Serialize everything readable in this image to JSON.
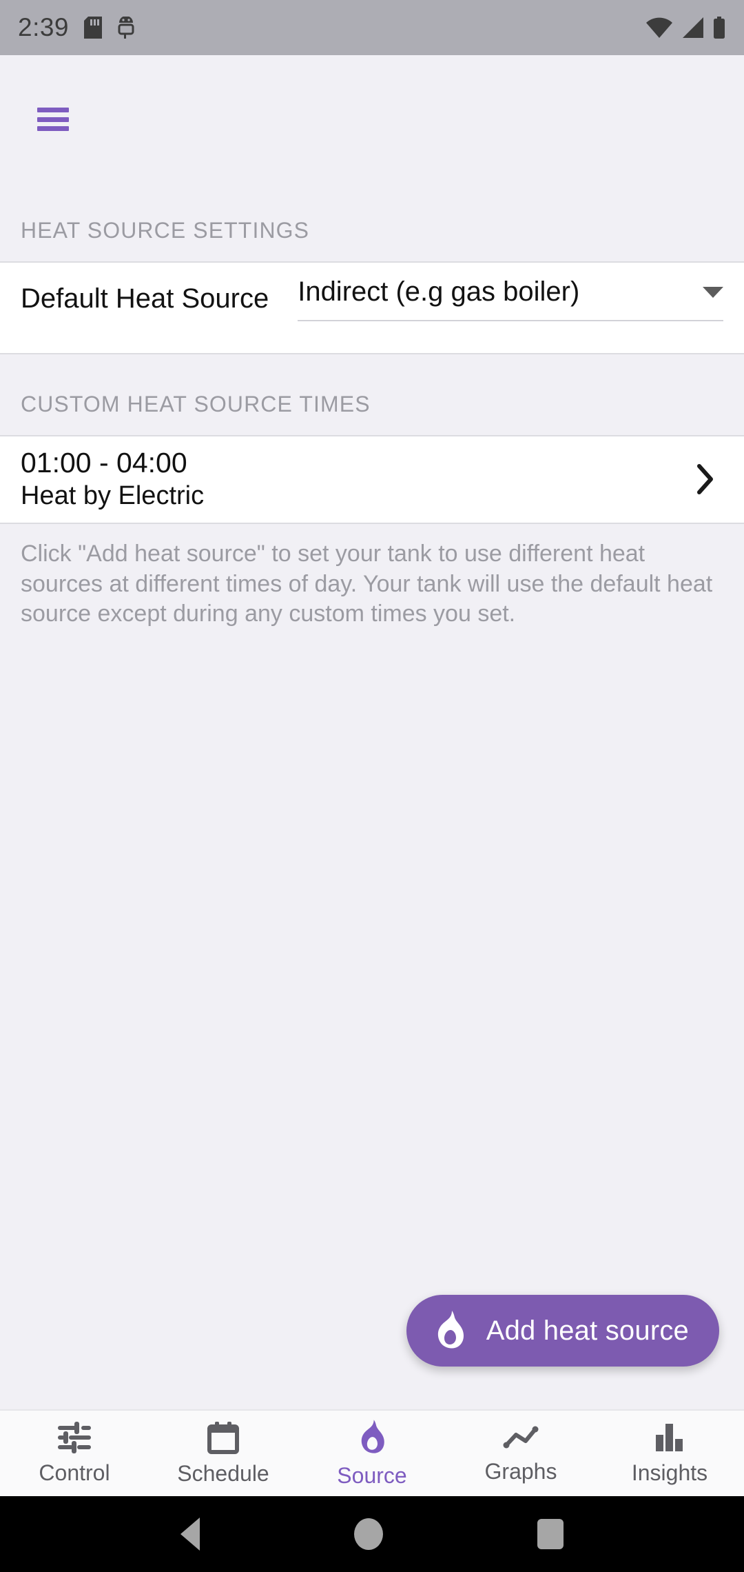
{
  "statusbar": {
    "time": "2:39",
    "icons": [
      "sd-card-icon",
      "android-debug-icon",
      "wifi-icon",
      "cellular-signal-icon",
      "battery-icon"
    ]
  },
  "appbar": {
    "menu_icon": "hamburger-menu-icon"
  },
  "sections": {
    "heat_source_settings": {
      "header": "HEAT SOURCE SETTINGS",
      "default_heat_source": {
        "label": "Default Heat Source",
        "value": "Indirect (e.g gas boiler)",
        "caret_icon": "chevron-down-icon"
      }
    },
    "custom_heat_source_times": {
      "header": "CUSTOM HEAT SOURCE TIMES",
      "entries": [
        {
          "time_range": "01:00 - 04:00",
          "description": "Heat by Electric",
          "chevron_icon": "chevron-right-icon"
        }
      ],
      "hint": "Click \"Add heat source\" to set your tank to use different heat sources at different times of day. Your tank will use the default heat source except during any custom times you set."
    }
  },
  "fab": {
    "label": "Add heat source",
    "icon": "flame-icon",
    "color": "#7d5bb0"
  },
  "bottomnav": {
    "active_index": 2,
    "items": [
      {
        "label": "Control",
        "icon": "tune-sliders-icon"
      },
      {
        "label": "Schedule",
        "icon": "calendar-icon"
      },
      {
        "label": "Source",
        "icon": "flame-icon"
      },
      {
        "label": "Graphs",
        "icon": "line-chart-icon"
      },
      {
        "label": "Insights",
        "icon": "bar-chart-icon"
      }
    ]
  },
  "androidnav": {
    "back": "back-triangle-icon",
    "home": "home-circle-icon",
    "recents": "recents-square-icon"
  },
  "colors": {
    "accent": "#7e5cc0",
    "fab": "#7d5bb0",
    "background": "#f1f0f5",
    "card": "#ffffff",
    "muted_text": "#9b9ba2"
  }
}
